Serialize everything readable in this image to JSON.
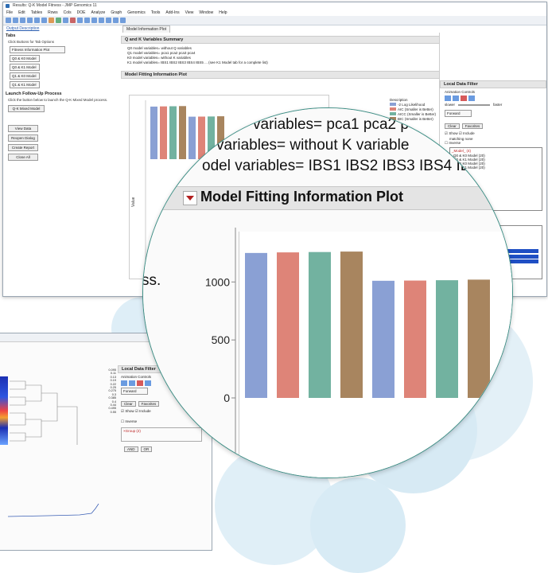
{
  "window_title": "Results: Q-K Model Fitness - JMP Genomics 11",
  "menu": [
    "File",
    "Edit",
    "Tables",
    "Rows",
    "Cols",
    "DOE",
    "Analyze",
    "Graph",
    "Genomics",
    "Tools",
    "Add-Ins",
    "View",
    "Window",
    "Help"
  ],
  "tabs": {
    "left": "Output Description",
    "main": "Model Information Plot"
  },
  "left_panel": {
    "tabs_title": "Tabs",
    "tabs_sub": "Click Buttons for Tab Options",
    "dropdowns": [
      "Fitness Information Plot",
      "Q0 & K0 Model",
      "Q0 & K1 Model",
      "Q1 & K0 Model",
      "Q1 & K1 Model"
    ],
    "launch_title": "Launch Follow-Up Process",
    "launch_sub": "Click the button below to launch the Q-K Mixed Model process.",
    "launch_button": "Q-K Mixed Model",
    "buttons": [
      "View Data",
      "Reopen Dialog",
      "Create Report",
      "Close All"
    ]
  },
  "summary": {
    "title": "Q and K Variables Summary",
    "lines": [
      "Q0 model variables= without Q variables",
      "Q1 model variables= pca1 pca2 pca3 pca4",
      "K0 model variables= without K variables",
      "K1 model variables= IBS1 IBS2 IBS3 IBS4 IBS5 ... (see K1 Model tab for a complete list)"
    ]
  },
  "plot_title": "Model Fitting Information Plot",
  "legend": {
    "title": "Description",
    "items": [
      "-2 Log Likelihood",
      "AIC (Smaller is Better)",
      "AICC (Smaller is Better)",
      "BIC (Smaller is Better)"
    ],
    "colors": [
      "#8aa0d4",
      "#de8478",
      "#72b2a0",
      "#a8855f"
    ]
  },
  "ylabel": "Value",
  "local_filter": {
    "title": "Local Data Filter",
    "animation": "Animation Controls",
    "slower": "slower",
    "faster": "faster",
    "direction": "Forward",
    "clear": "Clear",
    "favorites": "Favorites",
    "show": "Show",
    "include": "Include",
    "matching": "matching none",
    "inverse": "Inverse",
    "model_header": "_Model_ (4)",
    "models": [
      "Q0 & K0 Model (20)",
      "Q0 & K1 Model (20)",
      "Q1 & K0 Model (20)",
      "Q1 & K1 Model (20)"
    ],
    "desc_header": "Description (4)",
    "descs": [
      "-2 Log Likelihood (20)",
      "AIC (Smaller is Better) (20)",
      "AICC (Smaller is Better) (20)",
      "BIC (Smaller is Better) (20)"
    ],
    "and": "AND",
    "or": "OR",
    "ok": "OK"
  },
  "magnifier": {
    "lines": [
      "variables= pca1 pca2 p",
      "variables= without K variable",
      "odel variables= IBS1 IBS2 IBS3 IBS4 IBS5"
    ],
    "plot_title": "Model Fitting Information Plot",
    "partial": "ss.",
    "ticks": [
      "1000",
      "500",
      "0"
    ]
  },
  "chart_data": {
    "type": "bar",
    "categories": [
      "-2 Log Likelihood",
      "AIC (Smaller is Better)",
      "AICC (Smaller is Better)",
      "BIC (Smaller is Better)",
      "-2 Log Likelihood",
      "AIC (Smaller is Better)",
      "AICC (Smaller is Better)",
      "BIC (Smaller is Better)"
    ],
    "values": [
      1250,
      1255,
      1258,
      1262,
      1010,
      1012,
      1015,
      1020
    ],
    "ylim": [
      0,
      1400
    ],
    "colors": [
      "#8aa0d4",
      "#de8478",
      "#72b2a0",
      "#a8855f",
      "#8aa0d4",
      "#de8478",
      "#72b2a0",
      "#a8855f"
    ]
  },
  "second_window": {
    "filter_title": "Local Data Filter",
    "animation": "Animation Controls",
    "direction": "Forward",
    "clear": "Clear",
    "favorites": "Favorites",
    "show": "Show",
    "include": "Include",
    "inverse": "Inverse",
    "group": "×Group (2)",
    "and": "AND",
    "or": "OR",
    "color_scale": [
      "0.095",
      "0.11",
      "0.13",
      "0.19",
      "0.22",
      "0.25",
      "0.275",
      "0.3",
      "0.385",
      "0.4",
      "0.44",
      "0.495",
      "0.55"
    ]
  }
}
